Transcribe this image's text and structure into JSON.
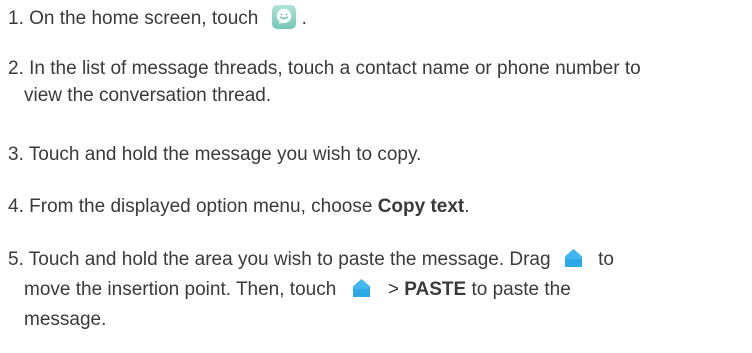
{
  "steps": [
    {
      "number": "1.",
      "text_before_icon": "On the home screen, touch",
      "icon": "messaging-app-icon",
      "text_after_icon": "."
    },
    {
      "number": "2.",
      "line1": "In the list of message threads, touch a contact name or phone number to",
      "line2": "view the conversation thread."
    },
    {
      "number": "3.",
      "text": "Touch and hold the message you wish to copy."
    },
    {
      "number": "4.",
      "text_before_bold": "From the displayed option menu, choose",
      "bold": "Copy text",
      "text_after_bold": "."
    },
    {
      "number": "5.",
      "line1_before_icon": "Touch and hold the area you wish to paste the message. Drag",
      "icon": "insertion-handle-icon",
      "line1_after_icon": "to",
      "line2_before_icon": "move the insertion point. Then, touch",
      "line2_after_icon_before_bold": ">",
      "bold": "PASTE",
      "line2_after_bold": "to paste the",
      "line3": "message."
    }
  ]
}
